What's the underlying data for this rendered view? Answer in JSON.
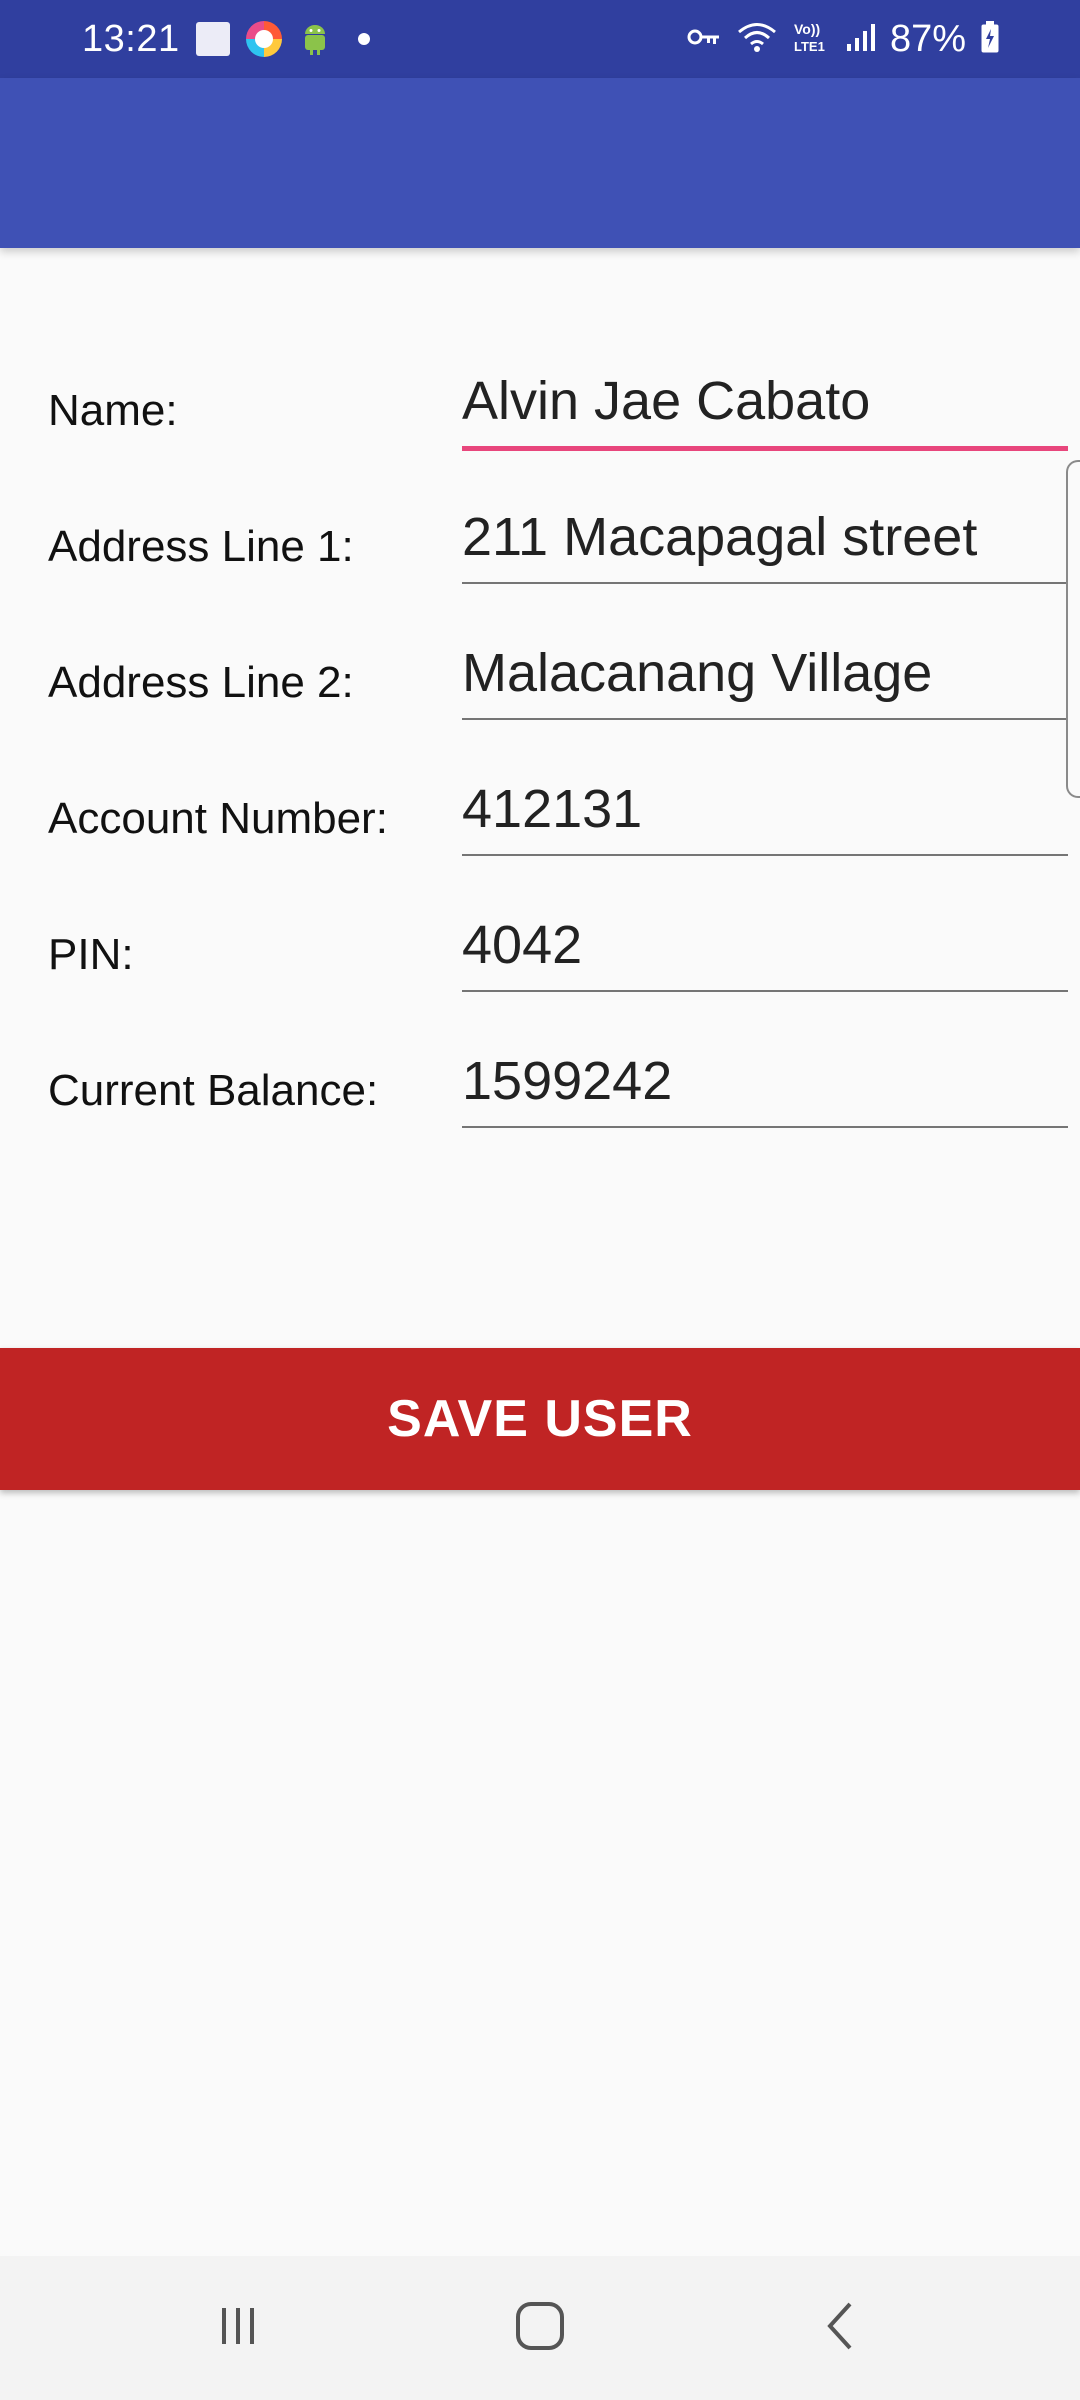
{
  "status_bar": {
    "time": "13:21",
    "battery": "87%",
    "icons": [
      "notification-square-icon",
      "browser-icon",
      "android-icon",
      "dot-icon",
      "vpn-key-icon",
      "wifi-icon",
      "volte-icon",
      "signal-icon",
      "battery-charging-icon"
    ]
  },
  "app_bar": {
    "color": "#3f51b5"
  },
  "form": {
    "fields": [
      {
        "label": "Name:",
        "value": "Alvin Jae Cabato",
        "focused": true
      },
      {
        "label": "Address Line 1:",
        "value": "211 Macapagal street",
        "focused": false
      },
      {
        "label": "Address Line 2:",
        "value": "Malacanang Village",
        "focused": false
      },
      {
        "label": "Account Number:",
        "value": "412131",
        "focused": false
      },
      {
        "label": "PIN:",
        "value": "4042",
        "focused": false
      },
      {
        "label": "Current Balance:",
        "value": "1599242",
        "focused": false
      }
    ]
  },
  "save_button": {
    "label": "SAVE USER",
    "color": "#c02424"
  },
  "nav_bar": {
    "buttons": [
      "recents-icon",
      "home-icon",
      "back-icon"
    ]
  },
  "colors": {
    "status_bar": "#303f9f",
    "accent_underline": "#e8467c",
    "background": "#fafafa"
  }
}
